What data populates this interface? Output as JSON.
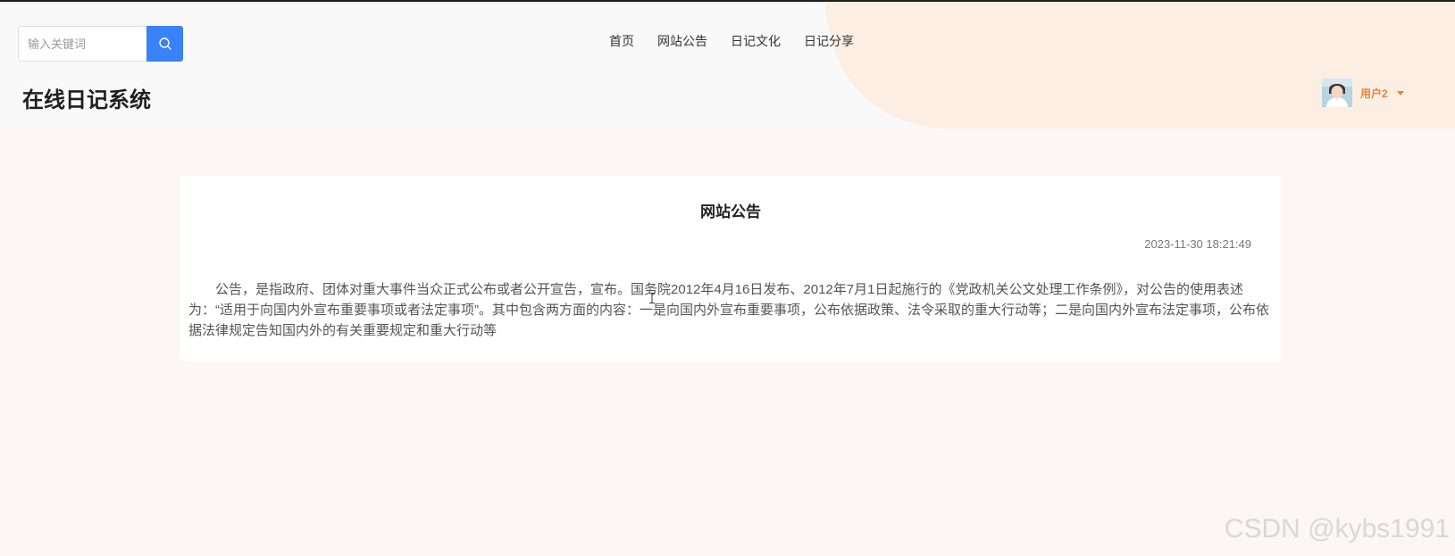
{
  "search": {
    "placeholder": "输入关键词"
  },
  "nav": {
    "items": [
      {
        "label": "首页"
      },
      {
        "label": "网站公告"
      },
      {
        "label": "日记文化"
      },
      {
        "label": "日记分享"
      }
    ]
  },
  "site_title": "在线日记系统",
  "user": {
    "name": "用户2"
  },
  "notice": {
    "title": "网站公告",
    "date": "2023-11-30 18:21:49",
    "content": "公告，是指政府、团体对重大事件当众正式公布或者公开宣告，宣布。国务院2012年4月16日发布、2012年7月1日起施行的《党政机关公文处理工作条例》，对公告的使用表述为：“适用于向国内外宣布重要事项或者法定事项”。其中包含两方面的内容：一是向国内外宣布重要事项，公布依据政策、法令采取的重大行动等；二是向国内外宣布法定事项，公布依据法律规定告知国内外的有关重要规定和重大行动等"
  },
  "watermark": "CSDN @kybs1991",
  "colors": {
    "accent_blue": "#3a82f7",
    "user_orange": "#e8843a",
    "header_bg": "#f9f9f9",
    "page_bg": "#fcf6f4"
  },
  "icons": {
    "search": "search-icon",
    "dropdown": "caret-down-icon",
    "avatar": "user-avatar"
  }
}
